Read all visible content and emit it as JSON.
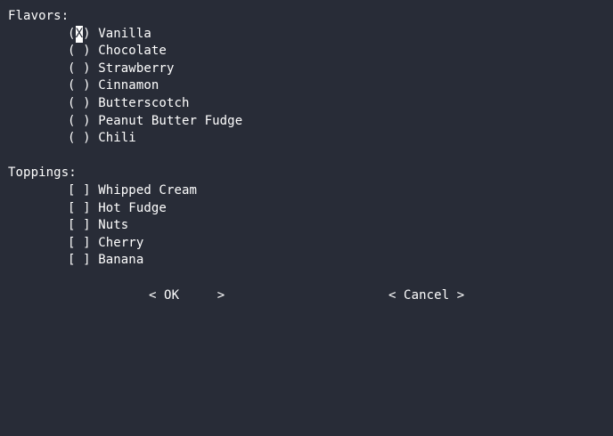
{
  "flavors": {
    "heading": "Flavors:",
    "options": [
      {
        "label": "Vanilla",
        "mark": "X",
        "selected": true
      },
      {
        "label": "Chocolate",
        "mark": " ",
        "selected": false
      },
      {
        "label": "Strawberry",
        "mark": " ",
        "selected": false
      },
      {
        "label": "Cinnamon",
        "mark": " ",
        "selected": false
      },
      {
        "label": "Butterscotch",
        "mark": " ",
        "selected": false
      },
      {
        "label": "Peanut Butter Fudge",
        "mark": " ",
        "selected": false
      },
      {
        "label": "Chili",
        "mark": " ",
        "selected": false
      }
    ]
  },
  "toppings": {
    "heading": "Toppings:",
    "options": [
      {
        "label": "Whipped Cream",
        "mark": " ",
        "checked": false
      },
      {
        "label": "Hot Fudge",
        "mark": " ",
        "checked": false
      },
      {
        "label": "Nuts",
        "mark": " ",
        "checked": false
      },
      {
        "label": "Cherry",
        "mark": " ",
        "checked": false
      },
      {
        "label": "Banana",
        "mark": " ",
        "checked": false
      }
    ]
  },
  "buttons": {
    "ok": "< OK     >",
    "cancel": "< Cancel >"
  },
  "colors": {
    "background": "#282c37",
    "foreground": "#ffffff"
  }
}
